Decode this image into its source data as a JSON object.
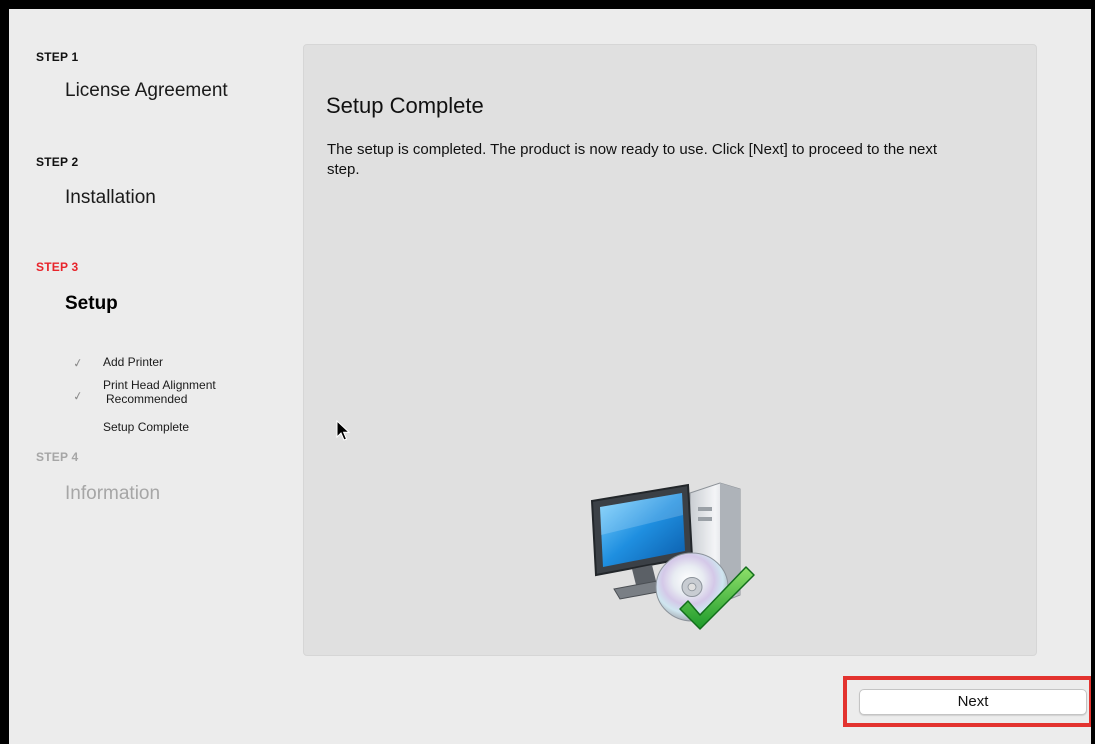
{
  "sidebar": {
    "steps": [
      {
        "label": "STEP 1",
        "title": "License Agreement",
        "state": "done"
      },
      {
        "label": "STEP 2",
        "title": "Installation",
        "state": "done"
      },
      {
        "label": "STEP 3",
        "title": "Setup",
        "state": "active"
      },
      {
        "label": "STEP 4",
        "title": "Information",
        "state": "disabled"
      }
    ],
    "substeps": [
      {
        "label": "Add Printer",
        "checked": true
      },
      {
        "label": "Print Head Alignment Recommended",
        "line1": "Print Head Alignment",
        "line2": "Recommended",
        "checked": true
      },
      {
        "label": "Setup Complete",
        "checked": false
      }
    ]
  },
  "main": {
    "title": "Setup Complete",
    "description": "The setup is completed. The product is now ready to use. Click [Next] to proceed to the next step.",
    "illustration_icon": "computer-disc-checkmark-icon"
  },
  "footer": {
    "next_label": "Next"
  },
  "colors": {
    "active_step": "#e8242b",
    "disabled_step": "#a6a6a6",
    "highlight_box": "#e3332f"
  }
}
